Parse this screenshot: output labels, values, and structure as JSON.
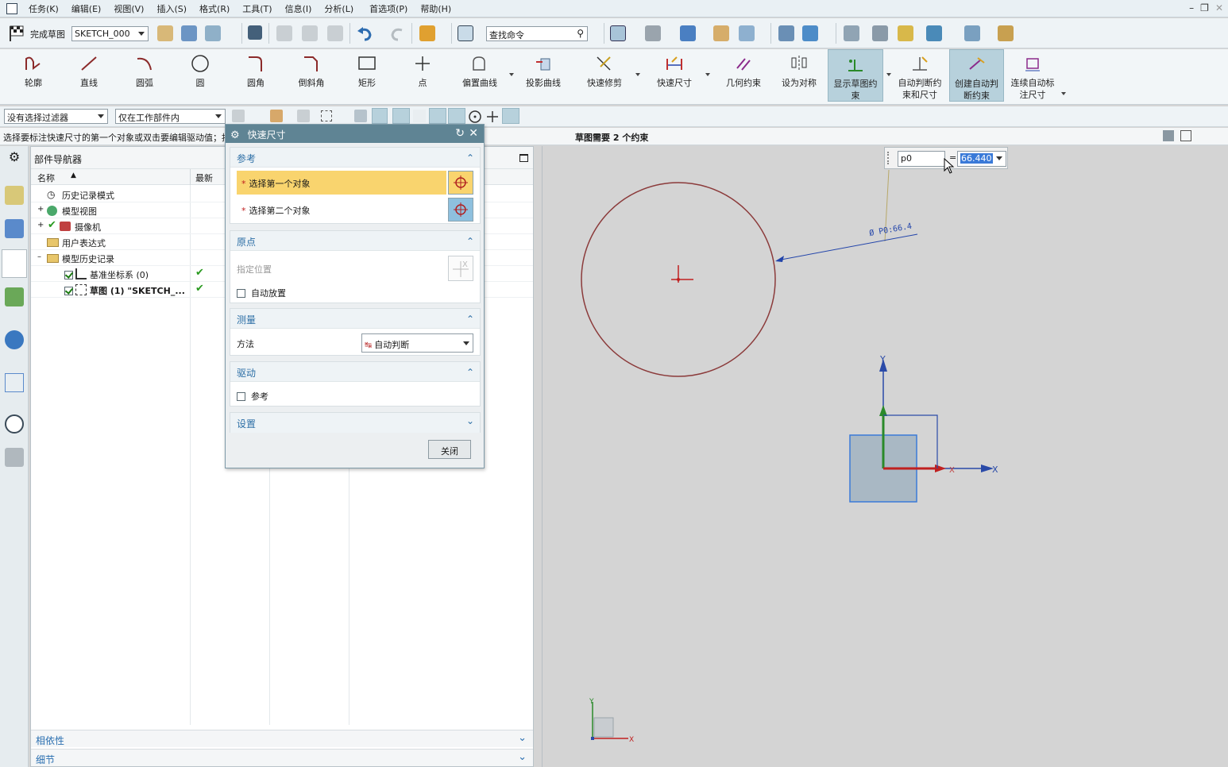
{
  "menu": {
    "items": [
      "任务(K)",
      "编辑(E)",
      "视图(V)",
      "插入(S)",
      "格式(R)",
      "工具(T)",
      "信息(I)",
      "分析(L)",
      "首选项(P)",
      "帮助(H)"
    ]
  },
  "toolbar": {
    "finish_sketch": "完成草图",
    "sketch_name": "SKETCH_000",
    "command_search_placeholder": "查找命令"
  },
  "ribbon": {
    "items": [
      {
        "label": "轮廓"
      },
      {
        "label": "直线"
      },
      {
        "label": "圆弧"
      },
      {
        "label": "圆"
      },
      {
        "label": "圆角"
      },
      {
        "label": "倒斜角"
      },
      {
        "label": "矩形"
      },
      {
        "label": "点"
      },
      {
        "label": "偏置曲线"
      },
      {
        "label": "投影曲线"
      },
      {
        "label": "快速修剪"
      },
      {
        "label": "快速尺寸"
      },
      {
        "label": "几何约束"
      },
      {
        "label": "设为对称"
      },
      {
        "label": "显示草图约束"
      },
      {
        "label": "自动判断约束和尺寸"
      },
      {
        "label": "创建自动判断约束"
      },
      {
        "label": "连续自动标注尺寸"
      }
    ]
  },
  "filters": {
    "selection_filter": "没有选择过滤器",
    "scope": "仅在工作部件内"
  },
  "status": {
    "prompt": "选择要标注快速尺寸的第一个对象或双击要编辑驱动值；按",
    "sketch_status": "草图需要 2 个约束"
  },
  "navigator": {
    "title": "部件导航器",
    "columns": {
      "name": "名称",
      "latest": "最新"
    },
    "rows": [
      {
        "label": "历史记录模式"
      },
      {
        "label": "模型视图"
      },
      {
        "label": "摄像机"
      },
      {
        "label": "用户表达式"
      },
      {
        "label": "模型历史记录"
      },
      {
        "label": "基准坐标系 (0)"
      },
      {
        "label": "草图 (1) \"SKETCH_..."
      }
    ],
    "sections": {
      "dependencies": "相依性",
      "details": "细节"
    }
  },
  "dialog": {
    "title": "快速尺寸",
    "groups": {
      "reference": {
        "title": "参考",
        "first": "选择第一个对象",
        "second": "选择第二个对象"
      },
      "origin": {
        "title": "原点",
        "specify": "指定位置",
        "auto_place": "自动放置"
      },
      "measure": {
        "title": "测量",
        "method_label": "方法",
        "method_value": "自动判断"
      },
      "driving": {
        "title": "驱动",
        "reference": "参考"
      },
      "settings": {
        "title": "设置"
      }
    },
    "close_label": "关闭"
  },
  "dimension_popup": {
    "name": "p0",
    "equals": "=",
    "value": "66.440"
  },
  "canvas": {
    "dimension_label": "Ø P0:66.4",
    "axis_x": "X",
    "axis_y": "Y"
  },
  "colors": {
    "accent": "#5f8494",
    "highlight": "#f9d46e",
    "circle": "#8b3a3a",
    "dimension": "#2244aa"
  }
}
